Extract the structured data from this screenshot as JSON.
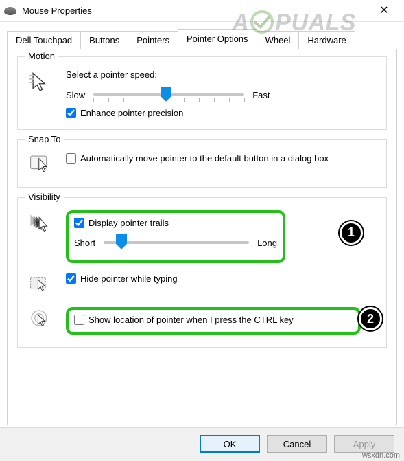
{
  "window": {
    "title": "Mouse Properties",
    "close_glyph": "✕"
  },
  "watermark": {
    "pre": "A",
    "post": "PUALS"
  },
  "source_mark": "wsxdn.com",
  "tabs": {
    "dell_touchpad": "Dell Touchpad",
    "buttons": "Buttons",
    "pointers": "Pointers",
    "pointer_options": "Pointer Options",
    "wheel": "Wheel",
    "hardware": "Hardware"
  },
  "motion": {
    "legend": "Motion",
    "heading": "Select a pointer speed:",
    "slow": "Slow",
    "fast": "Fast",
    "enhance": "Enhance pointer precision",
    "enhance_checked": true,
    "speed_position_pct": 48
  },
  "snapto": {
    "legend": "Snap To",
    "auto": "Automatically move pointer to the default button in a dialog box",
    "auto_checked": false
  },
  "visibility": {
    "legend": "Visibility",
    "trails": "Display pointer trails",
    "trails_checked": true,
    "trail_short": "Short",
    "trail_long": "Long",
    "trail_position_pct": 12,
    "hide": "Hide pointer while typing",
    "hide_checked": true,
    "ctrl": "Show location of pointer when I press the CTRL key",
    "ctrl_checked": false
  },
  "annotations": {
    "badge1": "1",
    "badge2": "2"
  },
  "buttons": {
    "ok": "OK",
    "cancel": "Cancel",
    "apply": "Apply"
  }
}
